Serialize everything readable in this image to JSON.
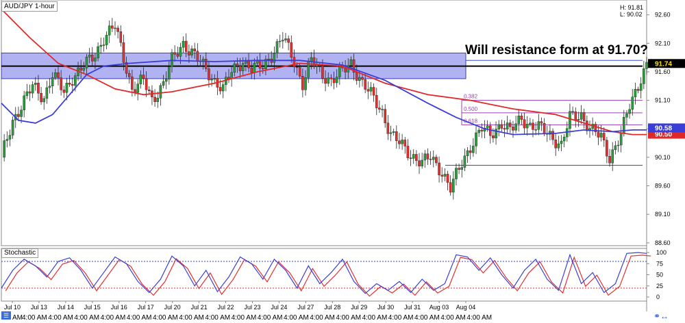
{
  "header": {
    "ticker": "AUD/JPY 1-hour",
    "high_label": "H: 91.81",
    "low_label": "L: 90.02"
  },
  "title": "Will resistance form at 91.70?",
  "price_tags": {
    "current": "91.74",
    "ma_blue": "90.58",
    "ma_red": "90.50"
  },
  "stochastic_label": "Stochastic",
  "stochastic_ticks": [
    "100",
    "75",
    "50",
    "25",
    "0"
  ],
  "fib_labels": [
    "0.382",
    "0.500",
    "0.618"
  ],
  "x_date_labels": [
    "Jul 10",
    "Jul 13",
    "Jul 14",
    "Jul 15",
    "Jul 16",
    "Jul 17",
    "Jul 20",
    "Jul 21",
    "Jul 22",
    "Jul 23",
    "Jul 24",
    "Jul 27",
    "Jul 28",
    "Jul 29",
    "Jul 30",
    "Jul 31",
    "Aug 03",
    "Aug 04"
  ],
  "x_time_label": "4:00 AM",
  "x_time_prefix": "AM",
  "colors": {
    "up": "#2a9d3a",
    "down": "#e03030",
    "ma_fast": "#3a3ed6",
    "ma_slow": "#e02828",
    "zone": "#7b7fe8",
    "fib": "#9a3fb0",
    "support": "#2a4bd0"
  },
  "chart_data": {
    "type": "candlestick",
    "instrument": "AUD/JPY",
    "timeframe": "1-hour",
    "y_axis_ticks": [
      92.6,
      92.1,
      91.6,
      91.1,
      90.6,
      90.1,
      89.6,
      89.1,
      88.6
    ],
    "ylim": [
      88.55,
      92.86
    ],
    "high": 91.81,
    "low": 90.02,
    "resistance_zone": [
      91.48,
      91.93
    ],
    "resistance_line": 91.7,
    "swing_high_line": 91.8,
    "support_line": 89.96,
    "fibonacci": [
      {
        "level": "0.382",
        "price": 91.1
      },
      {
        "level": "0.500",
        "price": 90.88
      },
      {
        "level": "0.618",
        "price": 90.67
      }
    ],
    "close_path": [
      [
        0,
        90.1
      ],
      [
        4,
        90.75
      ],
      [
        7,
        91.0
      ],
      [
        11,
        91.35
      ],
      [
        15,
        91.15
      ],
      [
        18,
        91.55
      ],
      [
        22,
        91.25
      ],
      [
        25,
        91.5
      ],
      [
        29,
        91.7
      ],
      [
        33,
        91.9
      ],
      [
        36,
        92.2
      ],
      [
        40,
        92.4
      ],
      [
        43,
        91.85
      ],
      [
        46,
        91.3
      ],
      [
        50,
        91.45
      ],
      [
        53,
        91.1
      ],
      [
        57,
        91.4
      ],
      [
        60,
        91.8
      ],
      [
        64,
        92.1
      ],
      [
        67,
        91.95
      ],
      [
        71,
        91.7
      ],
      [
        74,
        91.5
      ],
      [
        78,
        91.3
      ],
      [
        81,
        91.6
      ],
      [
        85,
        91.8
      ],
      [
        88,
        91.65
      ],
      [
        92,
        91.7
      ],
      [
        95,
        91.9
      ],
      [
        99,
        92.2
      ],
      [
        102,
        91.9
      ],
      [
        106,
        91.4
      ],
      [
        109,
        91.8
      ],
      [
        113,
        91.55
      ],
      [
        116,
        91.45
      ],
      [
        120,
        91.6
      ],
      [
        123,
        91.75
      ],
      [
        127,
        91.4
      ],
      [
        130,
        91.2
      ],
      [
        134,
        90.9
      ],
      [
        137,
        90.5
      ],
      [
        141,
        90.3
      ],
      [
        144,
        90.15
      ],
      [
        148,
        90.0
      ],
      [
        151,
        90.1
      ],
      [
        155,
        89.85
      ],
      [
        158,
        89.55
      ],
      [
        162,
        90.0
      ],
      [
        165,
        90.3
      ],
      [
        169,
        90.6
      ],
      [
        172,
        90.5
      ],
      [
        176,
        90.7
      ],
      [
        179,
        90.55
      ],
      [
        183,
        90.8
      ],
      [
        186,
        90.65
      ],
      [
        190,
        90.6
      ],
      [
        193,
        90.5
      ],
      [
        197,
        90.3
      ],
      [
        200,
        90.8
      ],
      [
        204,
        90.85
      ],
      [
        207,
        90.6
      ],
      [
        211,
        90.45
      ],
      [
        214,
        90.1
      ],
      [
        218,
        90.5
      ],
      [
        221,
        91.0
      ],
      [
        225,
        91.5
      ],
      [
        227,
        91.72
      ]
    ],
    "ma_fast_path": [
      [
        0,
        91.05
      ],
      [
        6,
        90.75
      ],
      [
        12,
        90.7
      ],
      [
        18,
        90.85
      ],
      [
        24,
        91.2
      ],
      [
        30,
        91.55
      ],
      [
        36,
        91.7
      ],
      [
        45,
        91.75
      ],
      [
        60,
        91.8
      ],
      [
        75,
        91.78
      ],
      [
        90,
        91.8
      ],
      [
        105,
        91.8
      ],
      [
        120,
        91.72
      ],
      [
        135,
        91.45
      ],
      [
        150,
        91.05
      ],
      [
        160,
        90.8
      ],
      [
        170,
        90.6
      ],
      [
        180,
        90.5
      ],
      [
        195,
        90.52
      ],
      [
        205,
        90.58
      ],
      [
        215,
        90.55
      ],
      [
        222,
        90.58
      ],
      [
        227,
        90.58
      ]
    ],
    "ma_slow_path": [
      [
        0,
        92.7
      ],
      [
        10,
        92.2
      ],
      [
        20,
        91.75
      ],
      [
        30,
        91.55
      ],
      [
        40,
        91.3
      ],
      [
        50,
        91.2
      ],
      [
        60,
        91.25
      ],
      [
        75,
        91.4
      ],
      [
        90,
        91.6
      ],
      [
        105,
        91.75
      ],
      [
        120,
        91.7
      ],
      [
        135,
        91.4
      ],
      [
        150,
        91.2
      ],
      [
        165,
        91.1
      ],
      [
        180,
        90.95
      ],
      [
        195,
        90.85
      ],
      [
        205,
        90.7
      ],
      [
        215,
        90.55
      ],
      [
        222,
        90.5
      ],
      [
        227,
        90.5
      ]
    ],
    "stochastic": {
      "levels": [
        80,
        20
      ],
      "k_path": [
        [
          0,
          20
        ],
        [
          4,
          60
        ],
        [
          8,
          85
        ],
        [
          12,
          70
        ],
        [
          16,
          45
        ],
        [
          20,
          80
        ],
        [
          24,
          88
        ],
        [
          28,
          60
        ],
        [
          32,
          20
        ],
        [
          36,
          55
        ],
        [
          40,
          90
        ],
        [
          44,
          75
        ],
        [
          48,
          35
        ],
        [
          52,
          10
        ],
        [
          56,
          40
        ],
        [
          60,
          92
        ],
        [
          64,
          70
        ],
        [
          68,
          25
        ],
        [
          72,
          60
        ],
        [
          76,
          12
        ],
        [
          80,
          45
        ],
        [
          84,
          90
        ],
        [
          88,
          75
        ],
        [
          92,
          40
        ],
        [
          96,
          85
        ],
        [
          100,
          60
        ],
        [
          104,
          20
        ],
        [
          108,
          70
        ],
        [
          112,
          30
        ],
        [
          116,
          55
        ],
        [
          120,
          85
        ],
        [
          124,
          35
        ],
        [
          128,
          8
        ],
        [
          132,
          30
        ],
        [
          136,
          15
        ],
        [
          140,
          35
        ],
        [
          144,
          10
        ],
        [
          148,
          40
        ],
        [
          152,
          15
        ],
        [
          156,
          30
        ],
        [
          160,
          95
        ],
        [
          164,
          90
        ],
        [
          168,
          60
        ],
        [
          172,
          88
        ],
        [
          176,
          50
        ],
        [
          180,
          20
        ],
        [
          184,
          60
        ],
        [
          188,
          85
        ],
        [
          192,
          40
        ],
        [
          196,
          15
        ],
        [
          200,
          95
        ],
        [
          204,
          30
        ],
        [
          208,
          55
        ],
        [
          212,
          10
        ],
        [
          216,
          30
        ],
        [
          220,
          98
        ],
        [
          224,
          100
        ],
        [
          227,
          98
        ]
      ]
    }
  }
}
